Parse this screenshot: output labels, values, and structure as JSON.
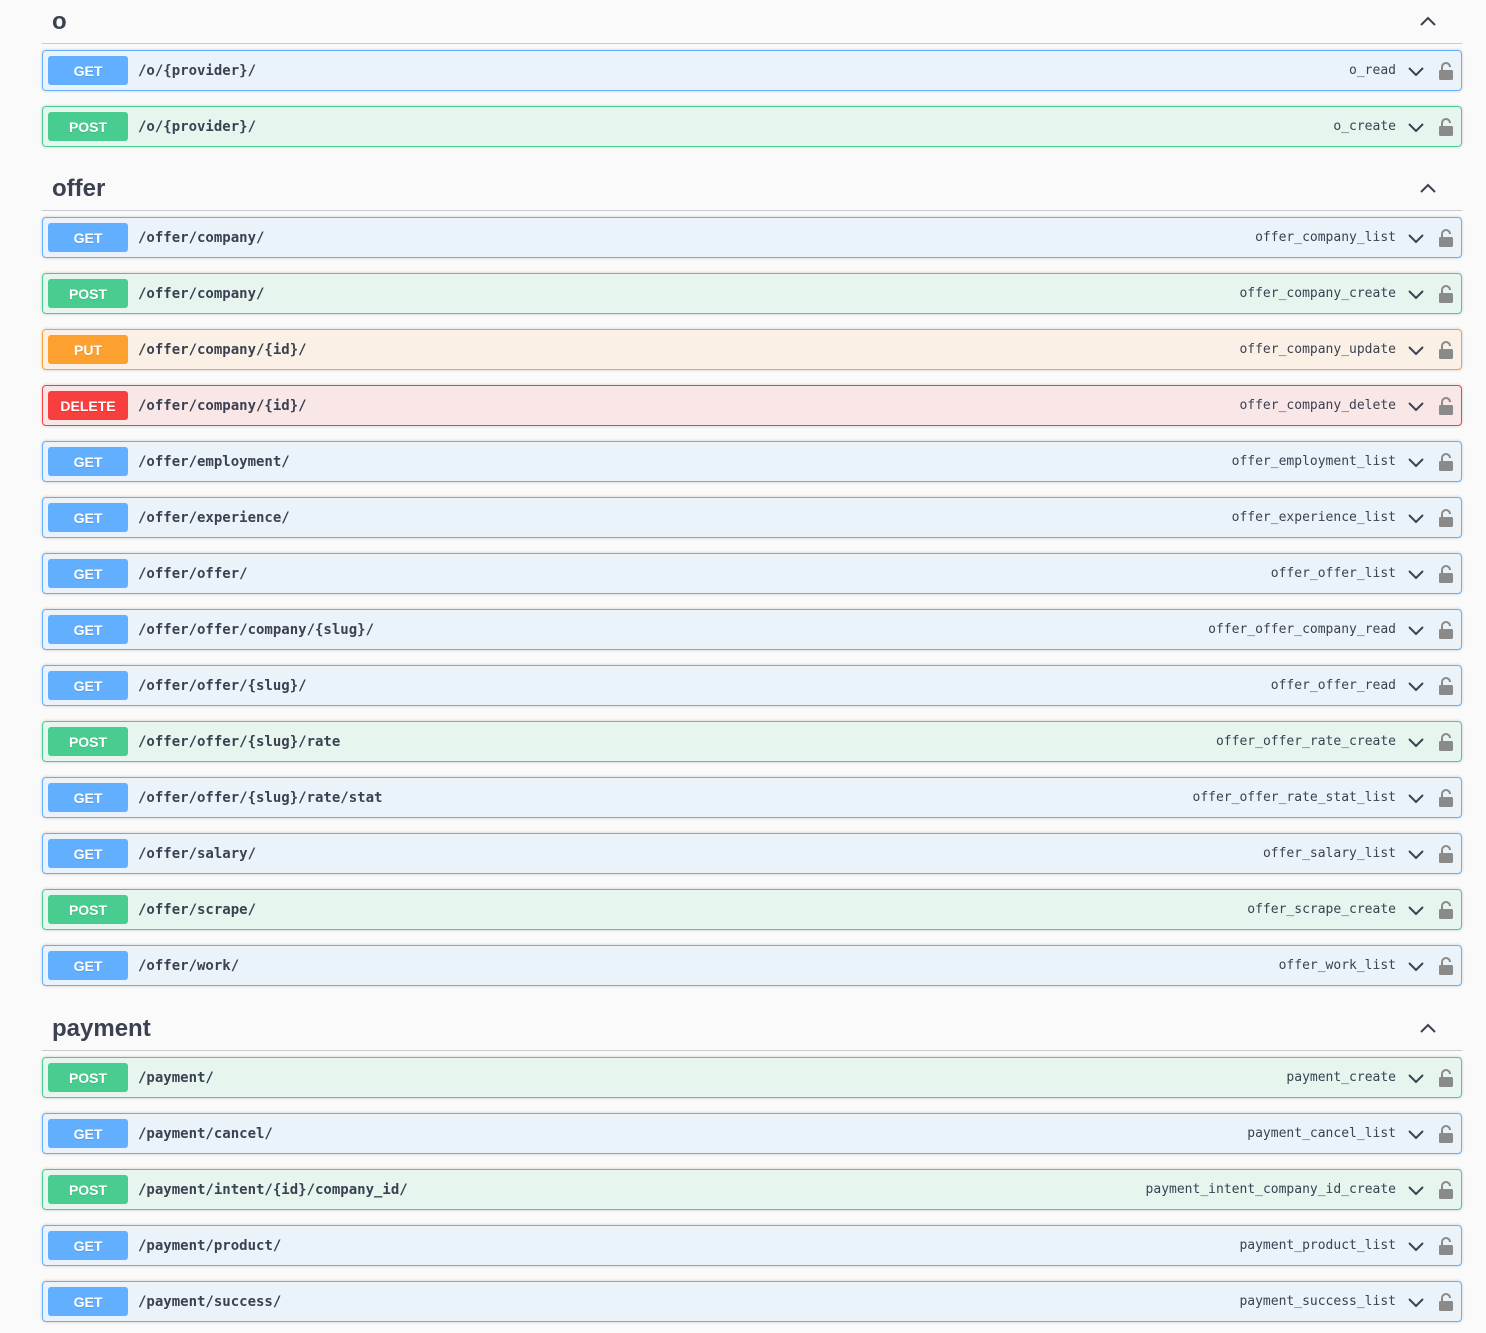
{
  "colors": {
    "get": "#61affe",
    "post": "#49cc90",
    "put": "#fca130",
    "delete": "#f93e3e"
  },
  "icons": {
    "tag_toggle": "chevron-up-icon",
    "op_toggle": "chevron-down-icon",
    "auth": "lock-icon"
  },
  "tags": [
    {
      "name": "o",
      "operations": [
        {
          "method": "GET",
          "path": "/o/{provider}/",
          "operation_id": "o_read"
        },
        {
          "method": "POST",
          "path": "/o/{provider}/",
          "operation_id": "o_create"
        }
      ]
    },
    {
      "name": "offer",
      "operations": [
        {
          "method": "GET",
          "path": "/offer/company/",
          "operation_id": "offer_company_list"
        },
        {
          "method": "POST",
          "path": "/offer/company/",
          "operation_id": "offer_company_create"
        },
        {
          "method": "PUT",
          "path": "/offer/company/{id}/",
          "operation_id": "offer_company_update"
        },
        {
          "method": "DELETE",
          "path": "/offer/company/{id}/",
          "operation_id": "offer_company_delete"
        },
        {
          "method": "GET",
          "path": "/offer/employment/",
          "operation_id": "offer_employment_list"
        },
        {
          "method": "GET",
          "path": "/offer/experience/",
          "operation_id": "offer_experience_list"
        },
        {
          "method": "GET",
          "path": "/offer/offer/",
          "operation_id": "offer_offer_list"
        },
        {
          "method": "GET",
          "path": "/offer/offer/company/{slug}/",
          "operation_id": "offer_offer_company_read"
        },
        {
          "method": "GET",
          "path": "/offer/offer/{slug}/",
          "operation_id": "offer_offer_read"
        },
        {
          "method": "POST",
          "path": "/offer/offer/{slug}/rate",
          "operation_id": "offer_offer_rate_create"
        },
        {
          "method": "GET",
          "path": "/offer/offer/{slug}/rate/stat",
          "operation_id": "offer_offer_rate_stat_list"
        },
        {
          "method": "GET",
          "path": "/offer/salary/",
          "operation_id": "offer_salary_list"
        },
        {
          "method": "POST",
          "path": "/offer/scrape/",
          "operation_id": "offer_scrape_create"
        },
        {
          "method": "GET",
          "path": "/offer/work/",
          "operation_id": "offer_work_list"
        }
      ]
    },
    {
      "name": "payment",
      "operations": [
        {
          "method": "POST",
          "path": "/payment/",
          "operation_id": "payment_create"
        },
        {
          "method": "GET",
          "path": "/payment/cancel/",
          "operation_id": "payment_cancel_list"
        },
        {
          "method": "POST",
          "path": "/payment/intent/{id}/company_id/",
          "operation_id": "payment_intent_company_id_create"
        },
        {
          "method": "GET",
          "path": "/payment/product/",
          "operation_id": "payment_product_list"
        },
        {
          "method": "GET",
          "path": "/payment/success/",
          "operation_id": "payment_success_list"
        }
      ]
    }
  ]
}
